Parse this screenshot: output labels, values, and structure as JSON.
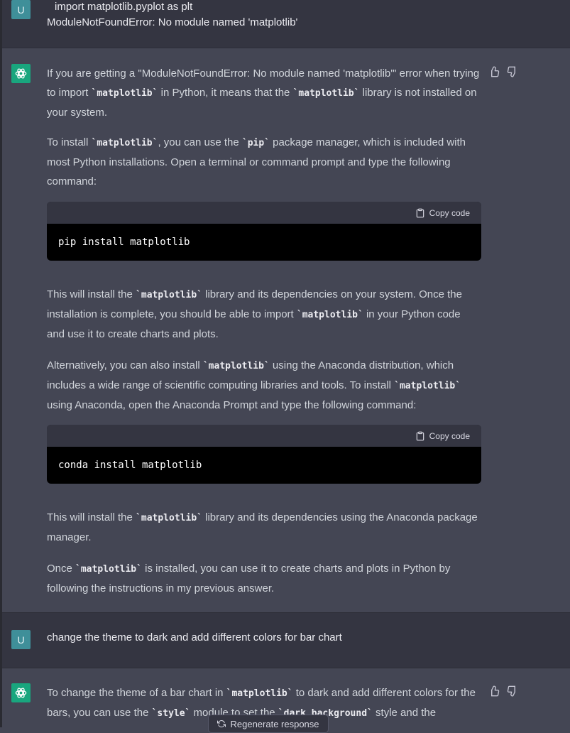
{
  "messages": {
    "user1": {
      "avatar": "U",
      "line1": "import matplotlib.pyplot as plt",
      "line2": "ModuleNotFoundError: No module named 'matplotlib'"
    },
    "bot1": {
      "p1": {
        "a": "If you are getting a \"ModuleNotFoundError: No module named 'matplotlib'\" error when trying to import ",
        "code1": "`matplotlib`",
        "b": " in Python, it means that the ",
        "code2": "`matplotlib`",
        "c": " library is not installed on your system."
      },
      "p2": {
        "a": "To install ",
        "code1": "`matplotlib`",
        "b": ", you can use the ",
        "code2": "`pip`",
        "c": " package manager, which is included with most Python installations. Open a terminal or command prompt and type the following command:"
      },
      "code_block1": {
        "copy_label": "Copy code",
        "code": "pip install matplotlib"
      },
      "p3": {
        "a": "This will install the ",
        "code1": "`matplotlib`",
        "b": " library and its dependencies on your system. Once the installation is complete, you should be able to import ",
        "code2": "`matplotlib`",
        "c": " in your Python code and use it to create charts and plots."
      },
      "p4": {
        "a": "Alternatively, you can also install ",
        "code1": "`matplotlib`",
        "b": " using the Anaconda distribution, which includes a wide range of scientific computing libraries and tools. To install ",
        "code2": "`matplotlib`",
        "c": " using Anaconda, open the Anaconda Prompt and type the following command:"
      },
      "code_block2": {
        "copy_label": "Copy code",
        "code": "conda install matplotlib"
      },
      "p5": {
        "a": "This will install the ",
        "code1": "`matplotlib`",
        "b": " library and its dependencies using the Anaconda package manager."
      },
      "p6": {
        "a": "Once ",
        "code1": "`matplotlib`",
        "b": " is installed, you can use it to create charts and plots in Python by following the instructions in my previous answer."
      }
    },
    "user2": {
      "avatar": "U",
      "text": "change the theme to dark and add different colors for bar chart"
    },
    "bot2": {
      "p1": {
        "a": "To change the theme of a bar chart in ",
        "code1": "`matplotlib`",
        "b": " to dark and add different colors for the bars, you can use the ",
        "code2": "`style`",
        "c": " module to set the ",
        "code3": "`dark_background`",
        "d": " style and the"
      }
    }
  },
  "footer": {
    "regenerate_label": "Regenerate response"
  },
  "icons": {
    "assistant_avatar": "openai-logo-icon",
    "thumbs_up": "thumbs-up-icon",
    "thumbs_down": "thumbs-down-icon",
    "clipboard": "clipboard-icon",
    "regenerate": "refresh-icon"
  },
  "colors": {
    "user_bg": "#343541",
    "assistant_bg": "#444654",
    "user_avatar": "#3f8f99",
    "assistant_avatar": "#19a67e",
    "code_bg": "#000000"
  }
}
